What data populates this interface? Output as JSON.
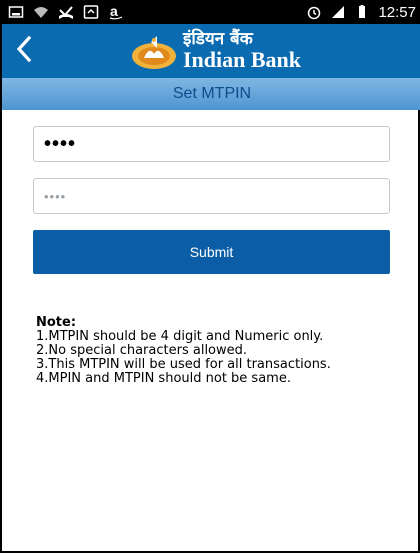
{
  "status_bar": {
    "time": "12:57",
    "icons": [
      "screenshot-icon",
      "wifi-icon",
      "missed-call-icon",
      "sync-icon",
      "amazon-icon",
      "alarm-icon",
      "signal-icon",
      "battery-icon"
    ]
  },
  "header": {
    "brand_hindi": "इंडियन बैंक",
    "brand_english": "Indian Bank",
    "brand_color": "#0b6bb1"
  },
  "title": "Set MTPIN",
  "form": {
    "pin_value": "••••",
    "confirm_placeholder": "••••",
    "submit_label": "Submit"
  },
  "note": {
    "heading": "Note:",
    "items": [
      "1.MTPIN should be 4 digit and Numeric only.",
      "2.No special characters allowed.",
      "3.This MTPIN will be used for all transactions.",
      "4.MPIN and MTPIN should not be same."
    ]
  }
}
